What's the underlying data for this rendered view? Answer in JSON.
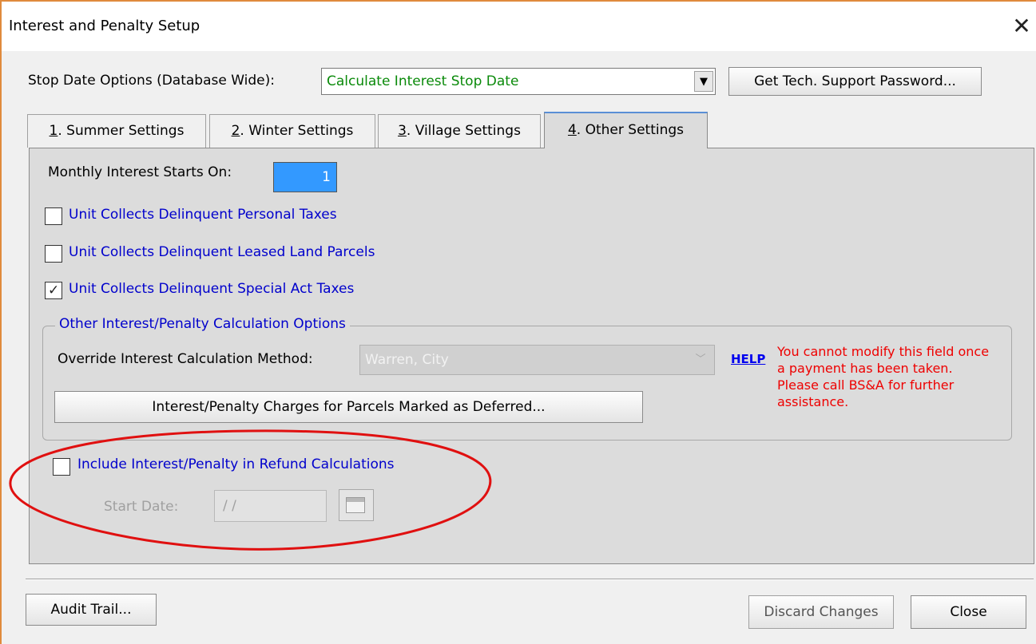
{
  "window": {
    "title": "Interest and Penalty Setup",
    "close_glyph": "✕"
  },
  "stop_date": {
    "label": "Stop Date Options (Database Wide):",
    "value": "Calculate Interest Stop Date",
    "value_color": "#0a8a0a"
  },
  "tech_support_button": "Get Tech. Support Password...",
  "tabs": [
    {
      "key": "1",
      "rest": ". Summer Settings",
      "active": false
    },
    {
      "key": "2",
      "rest": ". Winter Settings",
      "active": false
    },
    {
      "key": "3",
      "rest": ". Village Settings",
      "active": false
    },
    {
      "key": "4",
      "rest": ". Other Settings",
      "active": true
    }
  ],
  "other_settings": {
    "monthly_label": "Monthly Interest Starts On:",
    "monthly_value": "1",
    "checkboxes": [
      {
        "label": "Unit Collects Delinquent Personal Taxes",
        "checked": false
      },
      {
        "label": "Unit Collects Delinquent Leased Land Parcels",
        "checked": false
      },
      {
        "label": "Unit Collects Delinquent Special Act Taxes",
        "checked": true
      }
    ],
    "group": {
      "legend": "Other Interest/Penalty Calculation Options",
      "override_label": "Override Interest Calculation Method:",
      "override_value": "Warren, City",
      "help_link": "HELP",
      "warning": "You cannot modify this field once a payment has been taken.  Please call BS&A for further assistance.",
      "deferred_button": "Interest/Penalty Charges for Parcels Marked as Deferred..."
    },
    "refund": {
      "checkbox_label": "Include Interest/Penalty in Refund Calculations",
      "checked": false,
      "start_date_label": "Start Date:",
      "start_date_value": "/ /"
    }
  },
  "footer": {
    "audit_button": "Audit Trail...",
    "discard_button": "Discard Changes",
    "close_button": "Close"
  },
  "colors": {
    "link_blue": "#0000cc",
    "warning_red": "#ee0000",
    "annotation_red": "#e01010",
    "selection_blue": "#3399ff"
  }
}
